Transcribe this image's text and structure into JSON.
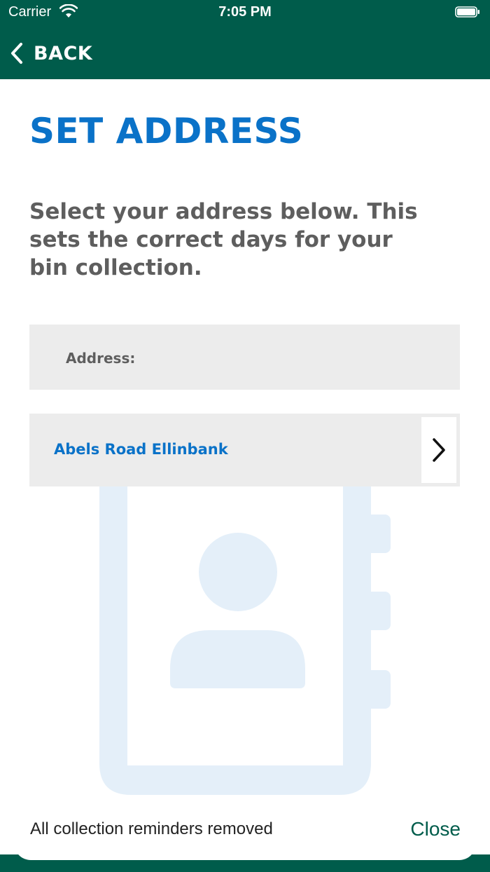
{
  "status_bar": {
    "carrier": "Carrier",
    "time": "7:05 PM",
    "icons": [
      "wifi-icon",
      "battery-icon"
    ]
  },
  "nav": {
    "back_label": "BACK",
    "back_icon": "chevron-left-icon"
  },
  "page": {
    "title": "SET ADDRESS",
    "instructions": "Select your address below. This sets the correct days for your bin collection."
  },
  "address_list": {
    "header_label": "Address:",
    "items": [
      {
        "label": "Abels Road Ellinbank",
        "icon": "chevron-right-icon"
      }
    ]
  },
  "snackbar": {
    "message": "All collection reminders removed",
    "action_label": "Close"
  },
  "colors": {
    "header_green": "#005c4b",
    "title_blue": "#0a72c8",
    "text_gray": "#5e5e5e",
    "row_gray": "#ececec",
    "illustration_blue": "#e4eff9"
  }
}
